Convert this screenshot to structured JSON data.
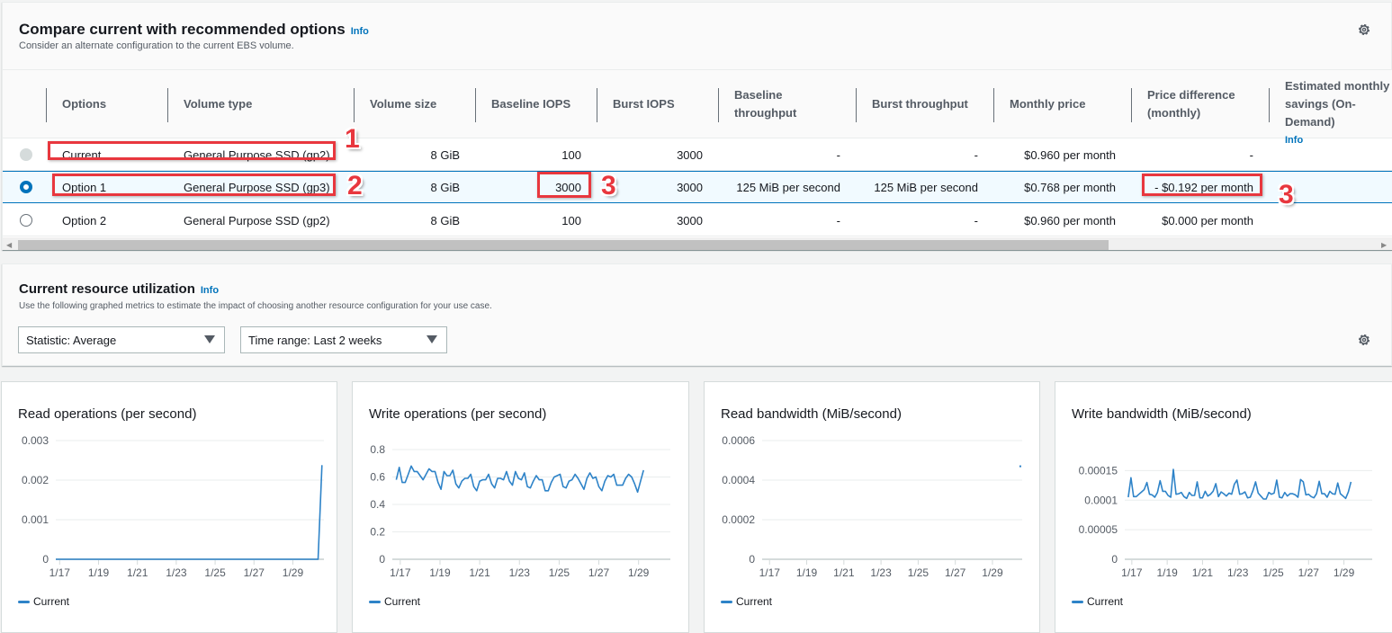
{
  "compare": {
    "title": "Compare current with recommended options",
    "info": "Info",
    "description": "Consider an alternate configuration to the current EBS volume.",
    "columns": [
      "Options",
      "Volume type",
      "Volume size",
      "Baseline IOPS",
      "Burst IOPS",
      "Baseline throughput",
      "Burst throughput",
      "Monthly price",
      "Price difference (monthly)",
      "Estimated monthly savings (On-Demand)"
    ],
    "savings_info": "Info",
    "rows": [
      {
        "option": "Current",
        "volume_type": "General Purpose SSD (gp2)",
        "volume_size": "8 GiB",
        "baseline_iops": "100",
        "burst_iops": "3000",
        "baseline_throughput": "-",
        "burst_throughput": "-",
        "monthly_price": "$0.960 per month",
        "price_difference": "-",
        "state": "disabled"
      },
      {
        "option": "Option 1",
        "volume_type": "General Purpose SSD (gp3)",
        "volume_size": "8 GiB",
        "baseline_iops": "3000",
        "burst_iops": "3000",
        "baseline_throughput": "125 MiB per second",
        "burst_throughput": "125 MiB per second",
        "monthly_price": "$0.768 per month",
        "price_difference": "- $0.192 per month",
        "state": "checked"
      },
      {
        "option": "Option 2",
        "volume_type": "General Purpose SSD (gp2)",
        "volume_size": "8 GiB",
        "baseline_iops": "100",
        "burst_iops": "3000",
        "baseline_throughput": "-",
        "burst_throughput": "-",
        "monthly_price": "$0.960 per month",
        "price_difference": "$0.000 per month",
        "state": "unchecked"
      }
    ],
    "annotations": [
      "1",
      "2",
      "3",
      "3"
    ]
  },
  "utilization": {
    "title": "Current resource utilization",
    "info": "Info",
    "description": "Use the following graphed metrics to estimate the impact of choosing another resource configuration for your use case.",
    "statistic_select": "Statistic: Average",
    "time_range_select": "Time range: Last 2 weeks"
  },
  "accent_color": "#0073bb",
  "series_color": "#2e83c8",
  "chart_data": [
    {
      "type": "line",
      "title": "Read operations (per second)",
      "x_ticks": [
        "1/17",
        "1/19",
        "1/21",
        "1/23",
        "1/25",
        "1/27",
        "1/29"
      ],
      "y_ticks": [
        "0",
        "0.001",
        "0.002",
        "0.003"
      ],
      "ylim": [
        0,
        0.003
      ],
      "x_range_days": [
        16.8,
        30.6
      ],
      "legend": "Current",
      "series": [
        {
          "name": "Current",
          "x": [
            16.8,
            30.3,
            30.5
          ],
          "values": [
            0,
            0,
            0.00238
          ]
        }
      ]
    },
    {
      "type": "line",
      "title": "Write operations (per second)",
      "x_ticks": [
        "1/17",
        "1/19",
        "1/21",
        "1/23",
        "1/25",
        "1/27",
        "1/29"
      ],
      "y_ticks": [
        "0",
        "0.2",
        "0.4",
        "0.6",
        "0.8"
      ],
      "ylim": [
        0,
        0.8
      ],
      "x_range_days": [
        16.6,
        30.6
      ],
      "legend": "Current",
      "series": [
        {
          "name": "Current",
          "step_days": 0.15,
          "x_start": 16.8,
          "values": [
            0.58,
            0.67,
            0.56,
            0.56,
            0.62,
            0.68,
            0.64,
            0.64,
            0.61,
            0.58,
            0.62,
            0.66,
            0.64,
            0.64,
            0.56,
            0.51,
            0.64,
            0.61,
            0.61,
            0.65,
            0.55,
            0.52,
            0.57,
            0.59,
            0.59,
            0.62,
            0.53,
            0.5,
            0.57,
            0.58,
            0.58,
            0.62,
            0.55,
            0.52,
            0.59,
            0.59,
            0.58,
            0.64,
            0.57,
            0.54,
            0.64,
            0.59,
            0.58,
            0.63,
            0.53,
            0.52,
            0.57,
            0.61,
            0.58,
            0.58,
            0.5,
            0.5,
            0.56,
            0.6,
            0.61,
            0.62,
            0.53,
            0.52,
            0.57,
            0.58,
            0.62,
            0.59,
            0.55,
            0.51,
            0.59,
            0.63,
            0.59,
            0.6,
            0.53,
            0.5,
            0.57,
            0.61,
            0.6,
            0.62,
            0.54,
            0.54,
            0.54,
            0.59,
            0.62,
            0.6,
            0.55,
            0.49,
            0.57,
            0.65
          ]
        }
      ]
    },
    {
      "type": "line",
      "title": "Read bandwidth (MiB/second)",
      "x_ticks": [
        "1/17",
        "1/19",
        "1/21",
        "1/23",
        "1/25",
        "1/27",
        "1/29"
      ],
      "y_ticks": [
        "0",
        "0.0002",
        "0.0004",
        "0.0006"
      ],
      "ylim": [
        0,
        0.0006
      ],
      "x_range_days": [
        16.6,
        30.6
      ],
      "legend": "Current",
      "series": [
        {
          "name": "Current",
          "x": [
            30.5
          ],
          "values": [
            0.00047
          ]
        }
      ]
    },
    {
      "type": "line",
      "title": "Write bandwidth (MiB/second)",
      "x_ticks": [
        "1/17",
        "1/19",
        "1/21",
        "1/23",
        "1/25",
        "1/27",
        "1/29"
      ],
      "y_ticks": [
        "0",
        "0.00005",
        "0.0001",
        "0.00015"
      ],
      "ylim": [
        0,
        0.000175
      ],
      "x_range_days": [
        16.6,
        30.6
      ],
      "legend": "Current",
      "series": [
        {
          "name": "Current",
          "step_days": 0.15,
          "x_start": 16.8,
          "values": [
            0.000105,
            0.000138,
            0.000106,
            0.000106,
            0.00011,
            0.000114,
            0.000118,
            0.00013,
            0.00011,
            0.000109,
            0.000105,
            0.000113,
            0.000133,
            0.000115,
            0.000115,
            0.000108,
            0.000105,
            0.000152,
            0.00011,
            0.000111,
            0.000113,
            0.000106,
            0.000103,
            0.000113,
            0.000108,
            0.000108,
            0.000131,
            0.000104,
            0.000104,
            0.000115,
            0.000107,
            0.00011,
            0.000115,
            0.000128,
            0.000106,
            0.000114,
            0.000111,
            0.000107,
            0.000112,
            0.00011,
            0.000127,
            0.000134,
            0.00011,
            0.000111,
            0.000114,
            0.000104,
            0.000105,
            0.000116,
            0.000131,
            0.000112,
            0.000107,
            0.000102,
            0.000102,
            0.000113,
            0.00011,
            0.000112,
            0.000134,
            0.000105,
            0.000104,
            0.000113,
            0.000107,
            0.000111,
            0.000111,
            0.000109,
            0.000105,
            0.000135,
            0.000131,
            0.000109,
            0.00011,
            0.000106,
            0.000104,
            0.000111,
            0.000132,
            0.000111,
            0.000111,
            0.000105,
            0.000115,
            0.000111,
            0.00011,
            0.000129,
            0.000111,
            0.000107,
            0.000103,
            0.000114,
            0.000131
          ]
        }
      ]
    }
  ]
}
